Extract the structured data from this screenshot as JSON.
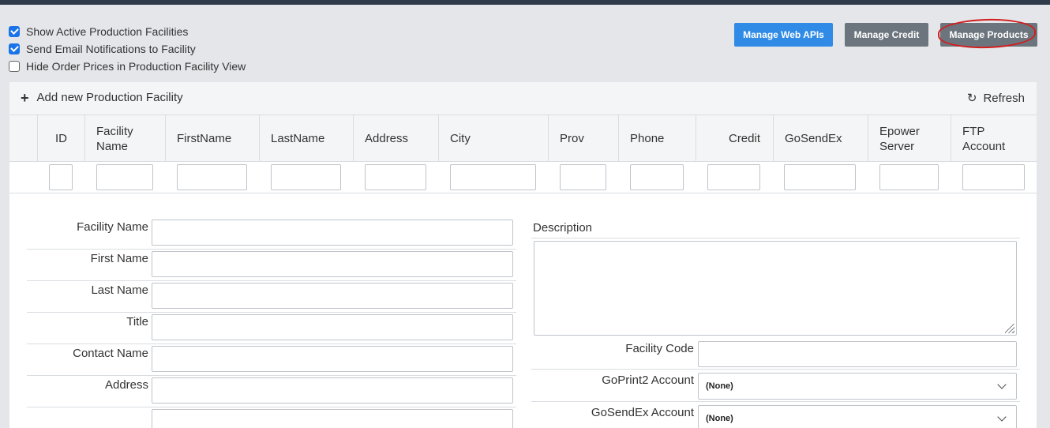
{
  "options": [
    {
      "label": "Show Active Production Facilities",
      "checked": true
    },
    {
      "label": "Send Email Notifications to Facility",
      "checked": true
    },
    {
      "label": "Hide Order Prices in Production Facility View",
      "checked": false
    }
  ],
  "buttons": {
    "web_apis": "Manage Web APIs",
    "credit": "Manage Credit",
    "products": "Manage Products"
  },
  "toolbar": {
    "add_new": "Add new Production Facility",
    "refresh": "Refresh"
  },
  "columns": [
    {
      "line1": "ID",
      "line2": ""
    },
    {
      "line1": "Facility",
      "line2": "Name"
    },
    {
      "line1": "FirstName",
      "line2": ""
    },
    {
      "line1": "LastName",
      "line2": ""
    },
    {
      "line1": "Address",
      "line2": ""
    },
    {
      "line1": "City",
      "line2": ""
    },
    {
      "line1": "Prov",
      "line2": ""
    },
    {
      "line1": "Phone",
      "line2": ""
    },
    {
      "line1": "Credit",
      "line2": ""
    },
    {
      "line1": "GoSendEx",
      "line2": ""
    },
    {
      "line1": "Epower",
      "line2": "Server"
    },
    {
      "line1": "FTP",
      "line2": "Account"
    }
  ],
  "form": {
    "left_labels": [
      "Facility Name",
      "First Name",
      "Last Name",
      "Title",
      "Contact Name",
      "Address"
    ],
    "description_label": "Description",
    "facility_code_label": "Facility Code",
    "goprint2_label": "GoPrint2 Account",
    "goprint2_value": "(None)",
    "gosendex_label": "GoSendEx Account",
    "gosendex_value": "(None)"
  },
  "colors": {
    "accent_blue": "#2f8be6",
    "button_gray": "#6c757d",
    "annotation_red": "#d21d1d"
  }
}
